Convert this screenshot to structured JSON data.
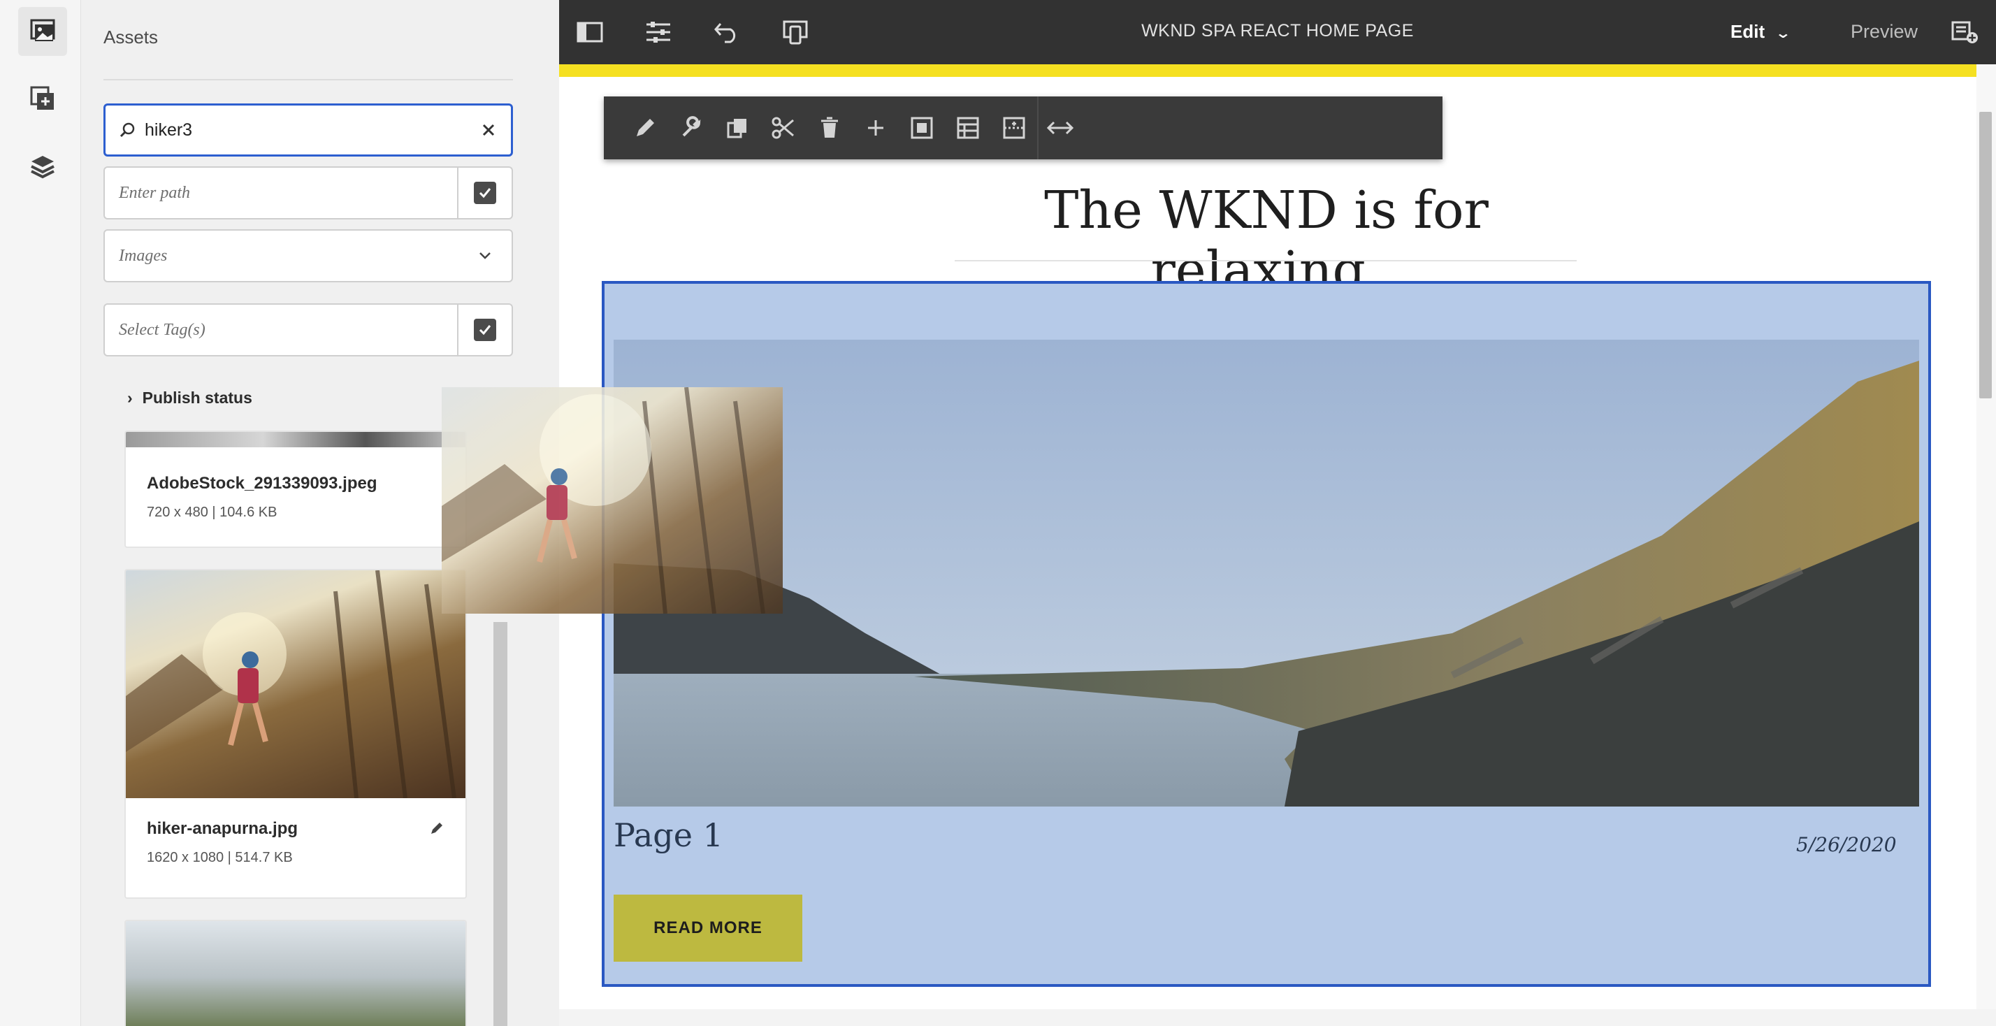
{
  "panel": {
    "title": "Assets",
    "search_value": "hiker3",
    "path_placeholder": "Enter path",
    "type_selected": "Images",
    "tags_placeholder": "Select Tag(s)",
    "publish_status_label": "Publish status",
    "assets": [
      {
        "name": "AdobeStock_291339093.jpeg",
        "meta": "720 x 480 | 104.6 KB"
      },
      {
        "name": "hiker-anapurna.jpg",
        "meta": "1620 x 1080 | 514.7 KB"
      }
    ]
  },
  "topbar": {
    "page_title": "WKND SPA REACT HOME PAGE",
    "mode_label": "Edit",
    "preview_label": "Preview"
  },
  "page": {
    "headline": "The WKND is for relaxing.",
    "card_title": "Page 1",
    "card_date": "5/26/2020",
    "read_more": "READ MORE"
  },
  "colors": {
    "topbar": "#323232",
    "accent_yellow": "#f5e021",
    "selection_border": "#2a58c2",
    "selection_fill": "#b6cae8",
    "read_more_button": "#bdb940"
  },
  "icons": {
    "rail": [
      "assets-icon",
      "components-icon",
      "content-tree-icon"
    ],
    "topbar": [
      "side-panel-toggle-icon",
      "page-properties-icon",
      "undo-icon",
      "emulator-icon",
      "annotations-icon"
    ],
    "component_toolbar": [
      "edit-pencil-icon",
      "configure-wrench-icon",
      "copy-icon",
      "cut-scissors-icon",
      "delete-trash-icon",
      "insert-plus-icon",
      "select-parent-icon",
      "layout-icon",
      "group-icon",
      "layout-resize-icon"
    ]
  }
}
